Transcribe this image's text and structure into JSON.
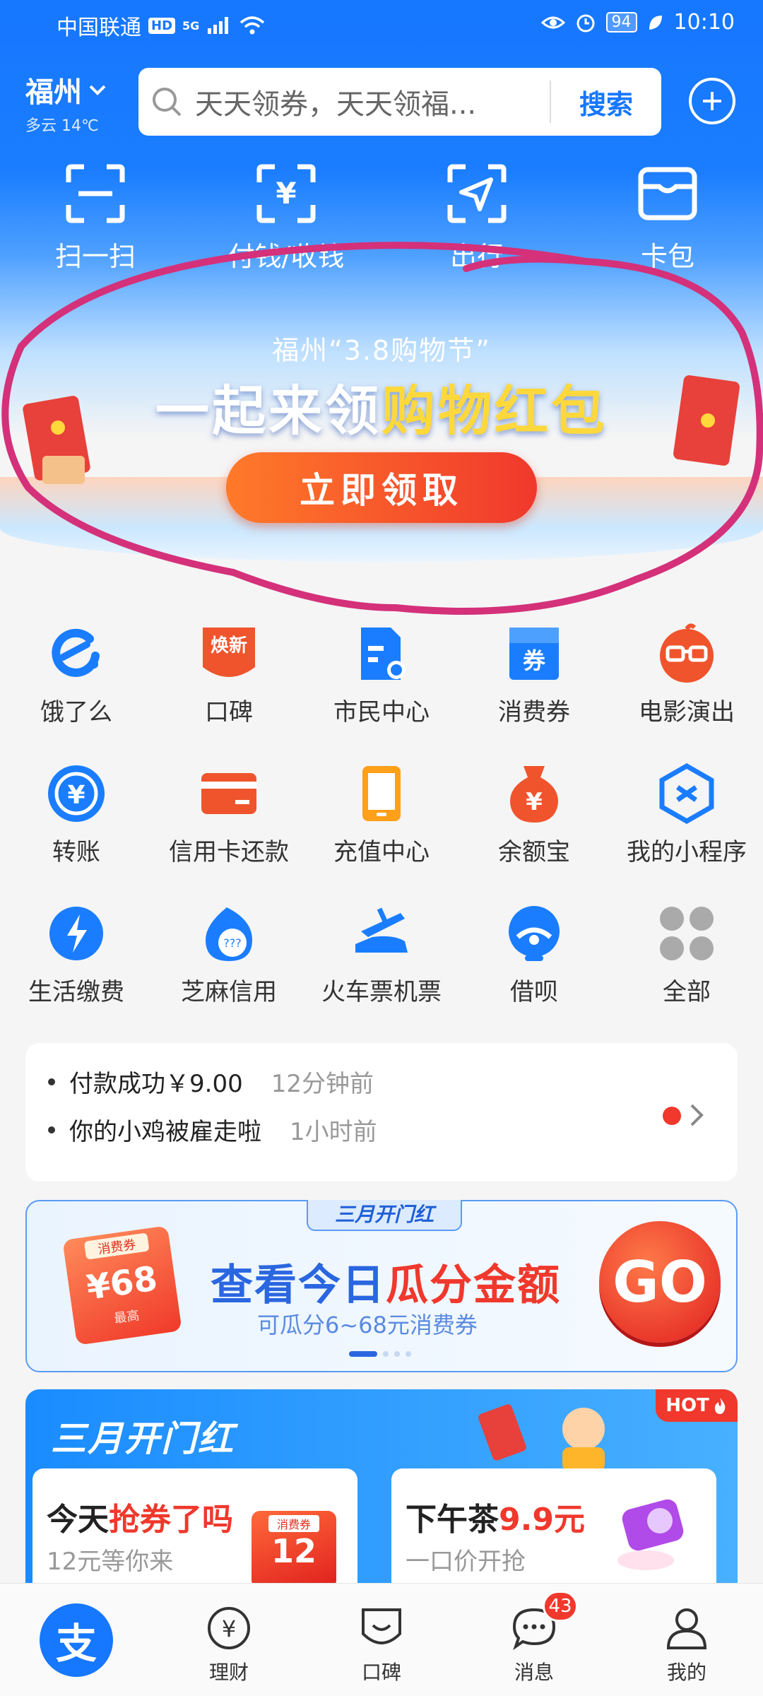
{
  "status_bar": {
    "carrier": "中国联通",
    "hd": "HD",
    "net": "5G",
    "battery": "94",
    "time": "10:10"
  },
  "header": {
    "city": "福州",
    "weather": "多云 14℃",
    "search_placeholder": "天天领券，天天领福...",
    "search_button": "搜索"
  },
  "quick_actions": [
    {
      "label": "扫一扫",
      "icon": "scan-icon"
    },
    {
      "label": "付钱/收钱",
      "icon": "pay-receive-icon"
    },
    {
      "label": "出行",
      "icon": "travel-icon"
    },
    {
      "label": "卡包",
      "icon": "card-wallet-icon"
    }
  ],
  "banner": {
    "subtitle": "福州“3.8购物节”",
    "title_main": "一起来领",
    "title_highlight": "购物红包",
    "cta": "立即领取"
  },
  "apps": [
    {
      "label": "饿了么",
      "icon": "eleme-icon"
    },
    {
      "label": "口碑",
      "icon": "koubei-icon",
      "sub": "焕新"
    },
    {
      "label": "市民中心",
      "icon": "citizen-center-icon"
    },
    {
      "label": "消费券",
      "icon": "coupon-icon",
      "sub": "券"
    },
    {
      "label": "电影演出",
      "icon": "movie-icon"
    },
    {
      "label": "转账",
      "icon": "transfer-icon"
    },
    {
      "label": "信用卡还款",
      "icon": "credit-card-icon"
    },
    {
      "label": "充值中心",
      "icon": "recharge-icon"
    },
    {
      "label": "余额宝",
      "icon": "yuebao-icon"
    },
    {
      "label": "我的小程序",
      "icon": "mini-program-icon"
    },
    {
      "label": "生活缴费",
      "icon": "utility-icon"
    },
    {
      "label": "芝麻信用",
      "icon": "sesame-credit-icon"
    },
    {
      "label": "火车票机票",
      "icon": "train-plane-icon"
    },
    {
      "label": "借呗",
      "icon": "jiebei-icon"
    },
    {
      "label": "全部",
      "icon": "all-apps-icon"
    }
  ],
  "notices": [
    {
      "text": "付款成功￥9.00",
      "time": "12分钟前"
    },
    {
      "text": "你的小鸡被雇走啦",
      "time": "1小时前"
    }
  ],
  "promo": {
    "tag": "三月开门红",
    "headline_blue": "查看今日",
    "headline_red": "瓜分金额",
    "sub": "可瓜分6~68元消费券",
    "go": "GO",
    "coupon_tag": "消费券",
    "coupon_value": "¥68",
    "coupon_foot": "最高"
  },
  "march": {
    "title": "三月开门红",
    "hot": "HOT",
    "cards": [
      {
        "h1": "今天",
        "h2": "抢券了吗",
        "sub": "12元等你来",
        "coupon_tag": "消费券",
        "coupon_value": "12"
      },
      {
        "h1": "下午茶",
        "h2": "9.9元",
        "sub": "一口价开抢"
      }
    ]
  },
  "tabbar": {
    "home_glyph": "支",
    "tabs": [
      {
        "label": "理财",
        "icon": "wealth-icon"
      },
      {
        "label": "口碑",
        "icon": "koubei-tab-icon"
      },
      {
        "label": "消息",
        "icon": "message-icon",
        "badge": "43"
      },
      {
        "label": "我的",
        "icon": "profile-icon"
      }
    ]
  },
  "colors": {
    "brand": "#1677ff",
    "red": "#f0382c",
    "annotation": "#d4317a"
  }
}
